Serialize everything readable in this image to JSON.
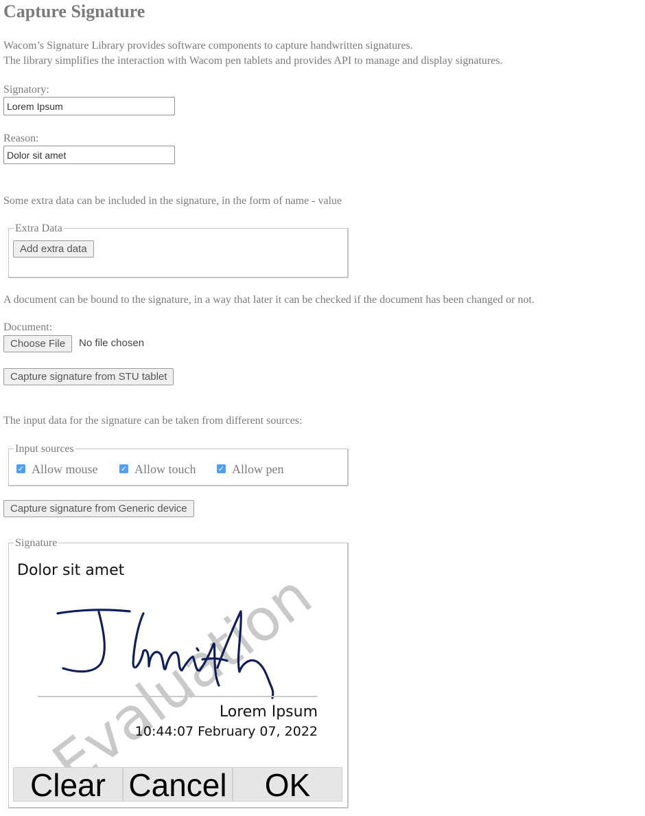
{
  "page": {
    "title": "Capture Signature",
    "intro_line1": "Wacom’s Signature Library provides software components to capture handwritten signatures.",
    "intro_line2": "The library simplifies the interaction with Wacom pen tablets and provides API to manage and display signatures."
  },
  "signatory": {
    "label": "Signatory:",
    "value": "Lorem Ipsum"
  },
  "reason": {
    "label": "Reason:",
    "value": "Dolor sit amet"
  },
  "extra": {
    "description": "Some extra data can be included in the signature, in the form of name - value",
    "legend": "Extra Data",
    "add_button": "Add extra data"
  },
  "document": {
    "description": "A document can be bound to the signature, in a way that later it can be checked if the document has been changed or not.",
    "label": "Document:",
    "choose_button": "Choose File",
    "file_status": "No file chosen"
  },
  "capture_stu_button": "Capture signature from STU tablet",
  "input_sources": {
    "description": "The input data for the signature can be taken from different sources:",
    "legend": "Input sources",
    "options": [
      {
        "label": "Allow mouse",
        "checked": true
      },
      {
        "label": "Allow touch",
        "checked": true
      },
      {
        "label": "Allow pen",
        "checked": true
      }
    ]
  },
  "capture_generic_button": "Capture signature from Generic device",
  "signature": {
    "legend": "Signature",
    "reason_text": "Dolor sit amet",
    "signer_name": "Lorem Ipsum",
    "timestamp": "10:44:07 February 07, 2022",
    "watermark": "Evaluation",
    "ink_color": "#0f1f5c",
    "buttons": {
      "clear": "Clear",
      "cancel": "Cancel",
      "ok": "OK"
    }
  }
}
